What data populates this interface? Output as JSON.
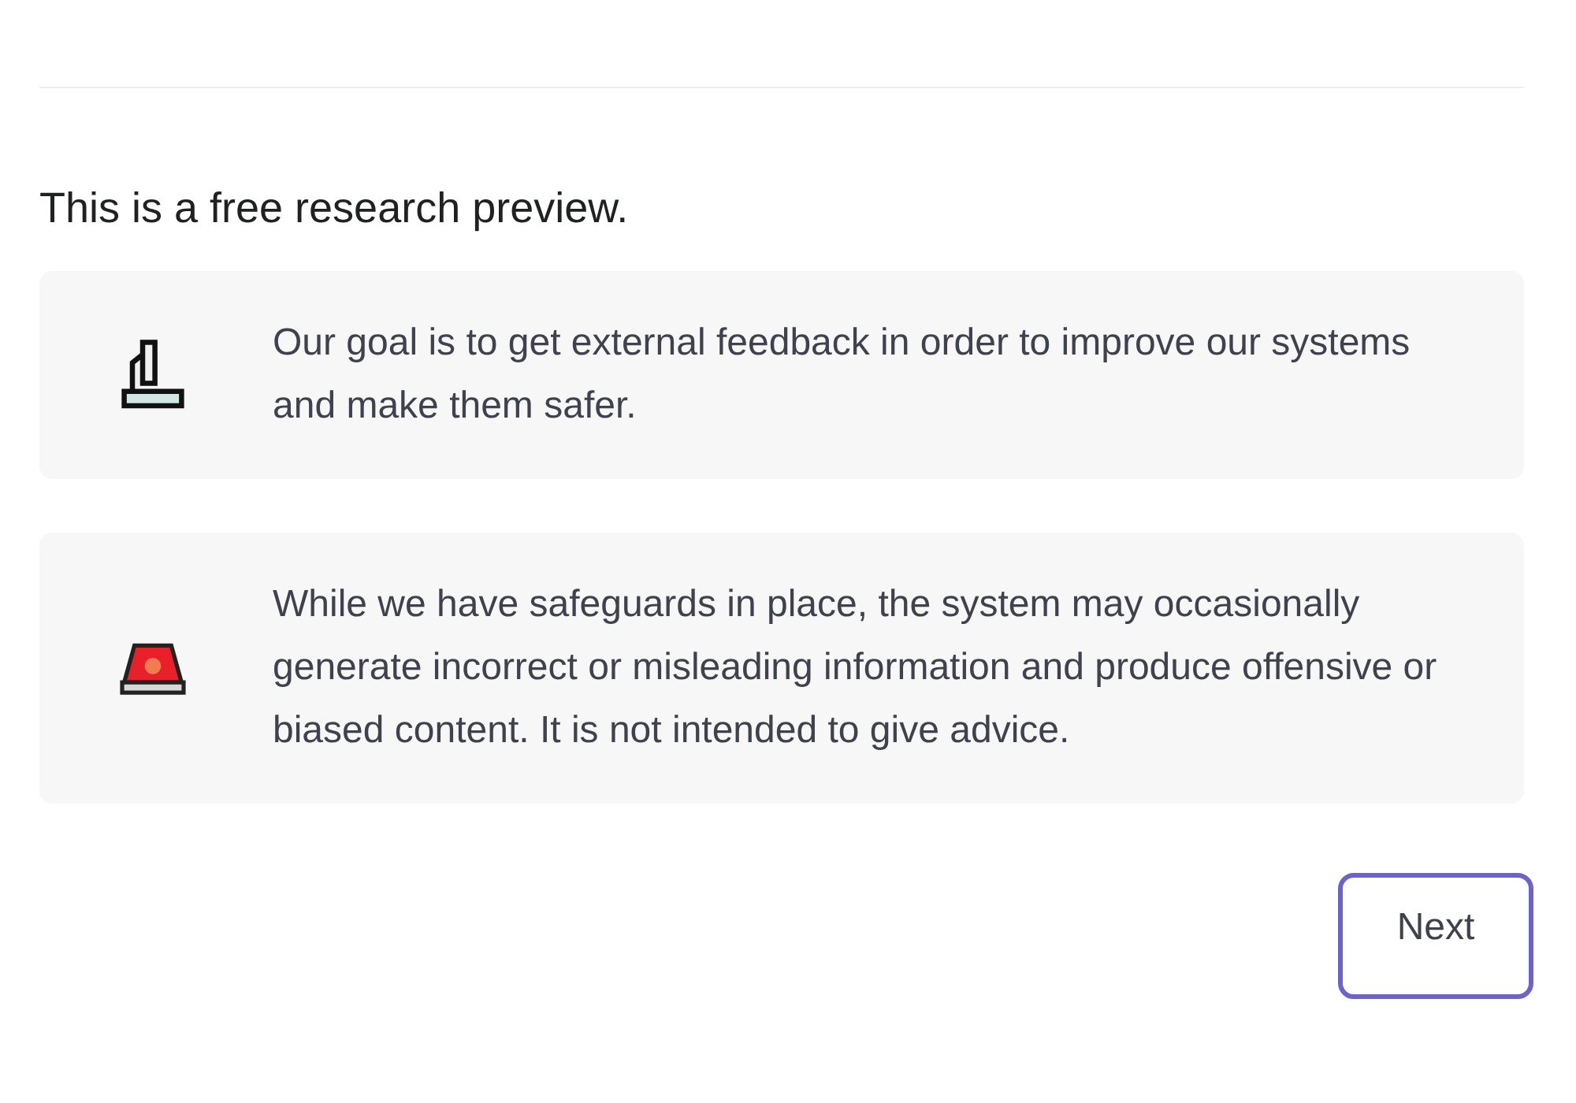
{
  "heading": "This is a free research preview.",
  "notices": [
    {
      "kind": "microscope",
      "text": "Our goal is to get external feedback in order to improve our systems and make them safer."
    },
    {
      "kind": "siren",
      "text": "While we have safeguards in place, the system may occasionally generate incorrect or misleading information and produce offensive or biased content. It is not intended to give advice."
    }
  ],
  "button": {
    "label": "Next",
    "focused": true
  }
}
